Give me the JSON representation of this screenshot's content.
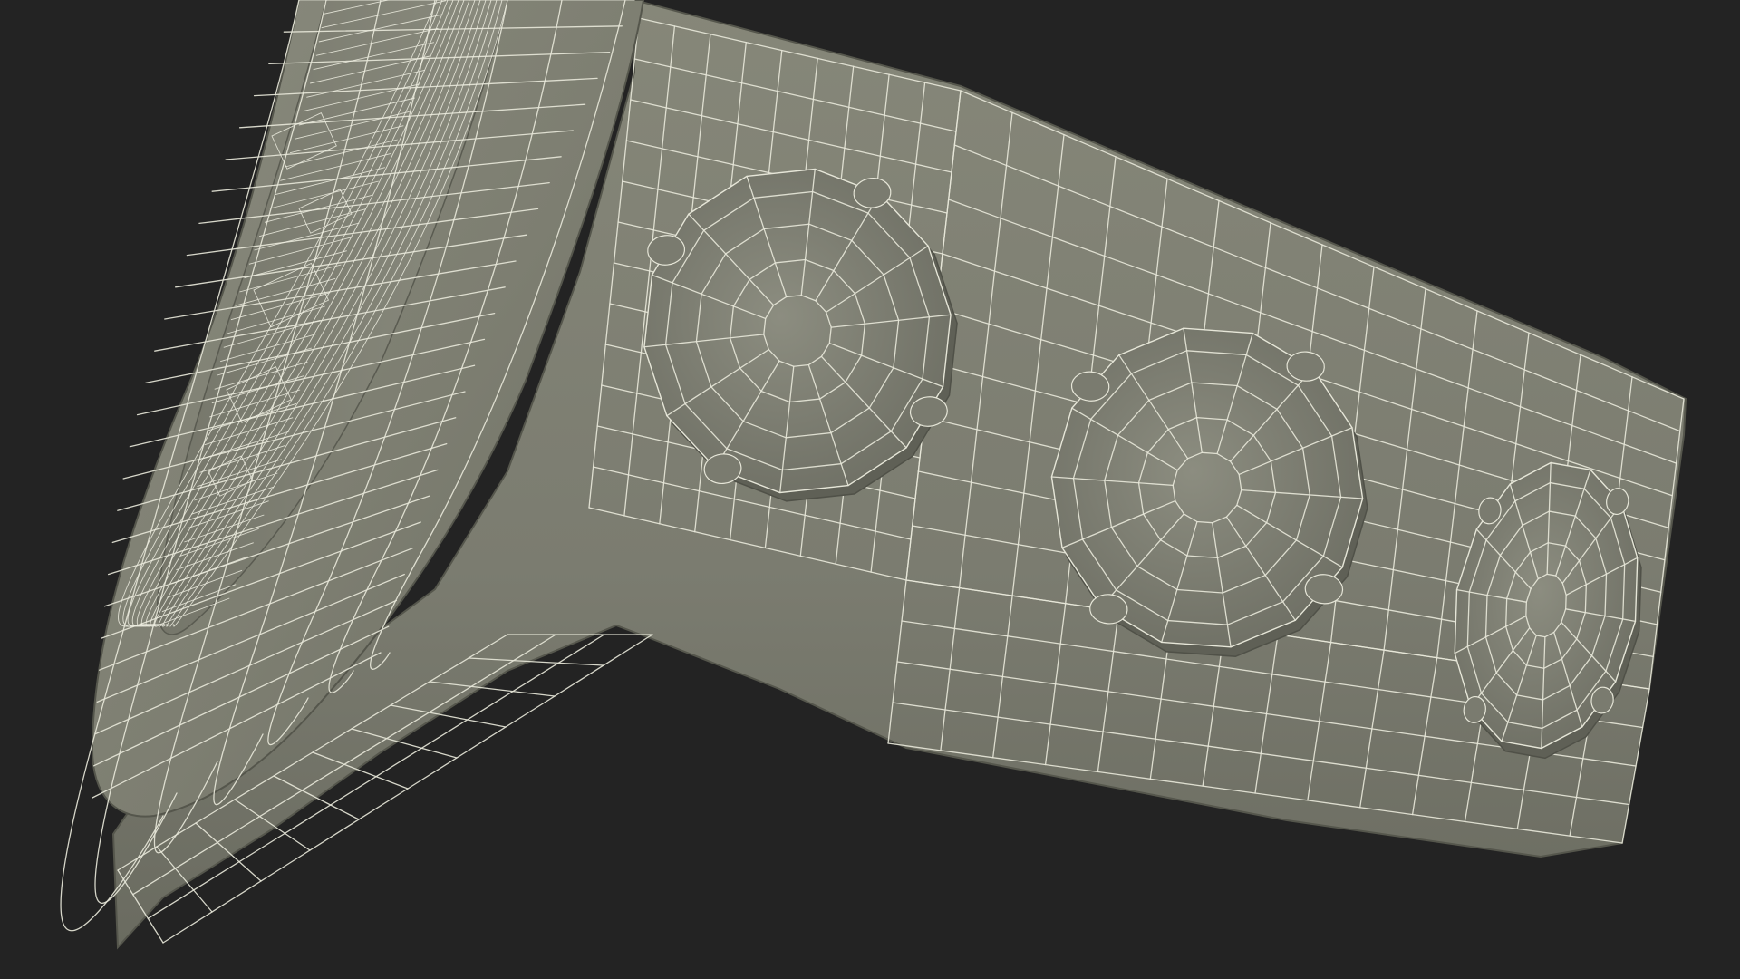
{
  "colors": {
    "background": "#232323",
    "surface": "#7e7f72",
    "surface_dark": "#6a6b60",
    "surface_light": "#8e8f82",
    "wire": "#e6e6d8",
    "detail_wire": "#f2f2e8"
  },
  "scene": {
    "subject": "wireframe-3d-model",
    "parts": [
      "bezel-rim",
      "strap-lug",
      "crown-knob",
      "crown-knob",
      "crown-knob"
    ]
  }
}
